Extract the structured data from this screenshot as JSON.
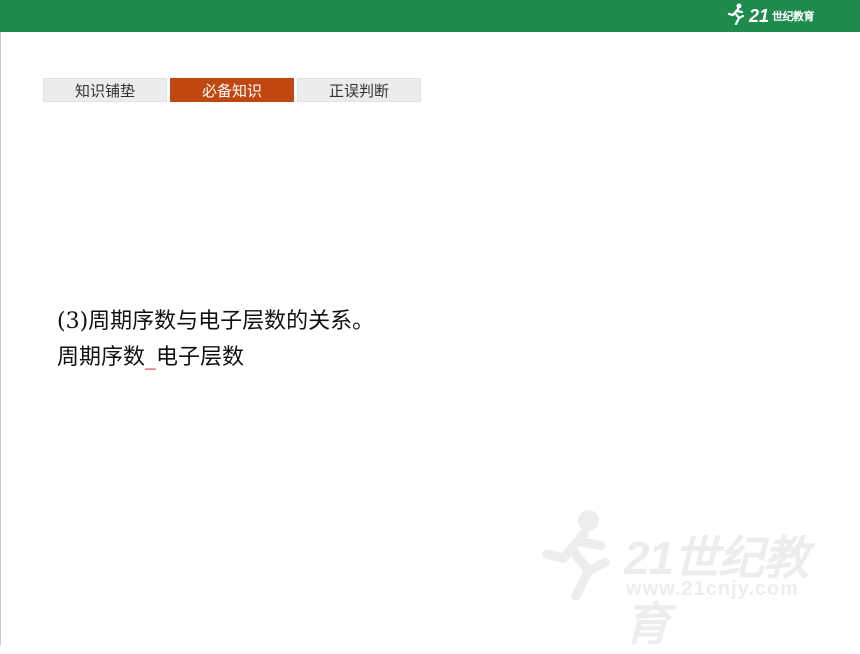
{
  "header": {
    "logo": {
      "icon": "runner-icon",
      "mark": "21",
      "word": "世纪教育",
      "color": "#ffffff"
    },
    "bar_color": "#1e8a4e"
  },
  "tabs": [
    {
      "label": "知识铺垫",
      "active": false
    },
    {
      "label": "必备知识",
      "active": true
    },
    {
      "label": "正误判断",
      "active": false
    }
  ],
  "accent_color": "#c0470f",
  "content": {
    "line1": "(3)周期序数与电子层数的关系。",
    "line2_prefix": "周期序数",
    "line2_blank": "_",
    "line2_suffix": "电子层数",
    "blank_color": "#cc1111"
  },
  "watermark": {
    "icon": "runner-icon",
    "text": "21世纪教育",
    "url": "www.21cnjy.com"
  }
}
